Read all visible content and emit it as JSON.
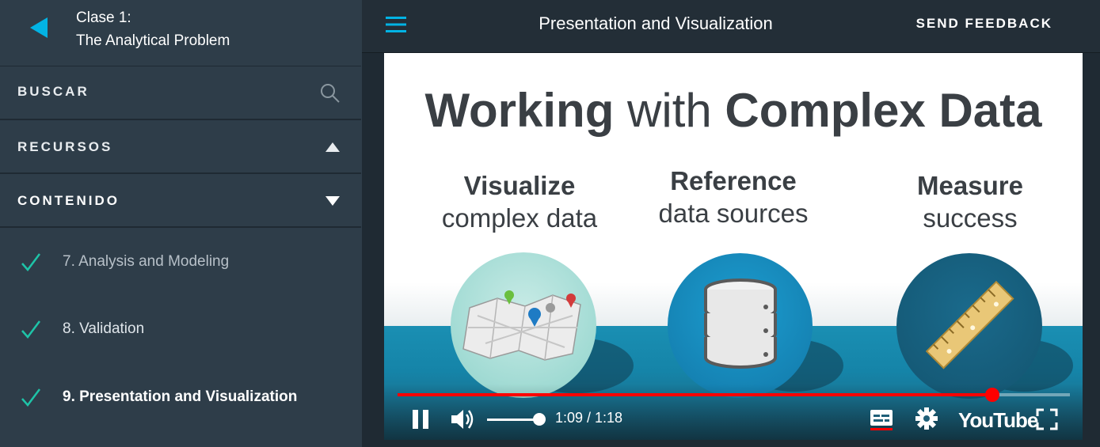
{
  "sidebar": {
    "course_line1": "Clase 1:",
    "course_line2": "The Analytical Problem",
    "buscar_label": "BUSCAR",
    "recursos_label": "RECURSOS",
    "contenido_label": "CONTENIDO",
    "lessons": [
      {
        "label": "7. Analysis and Modeling",
        "completed": true
      },
      {
        "label": "8. Validation",
        "completed": true
      },
      {
        "label": "9. Presentation and Visualization",
        "completed": true,
        "active": true
      }
    ]
  },
  "header": {
    "title": "Presentation and Visualization",
    "feedback_label": "SEND FEEDBACK"
  },
  "video": {
    "slide_title_bold1": "Working",
    "slide_title_regular": " with ",
    "slide_title_bold2": "Complex Data",
    "columns": [
      {
        "heading": "Visualize",
        "sub": "complex data",
        "icon": "map-icon"
      },
      {
        "heading": "Reference",
        "sub": "data sources",
        "icon": "database-icon"
      },
      {
        "heading": "Measure",
        "sub": "success",
        "icon": "ruler-icon"
      }
    ],
    "time_display": "1:09 / 1:18",
    "progress_fraction": 0.885,
    "volume_fraction": 0.9,
    "youtube_label": "YouTube"
  },
  "colors": {
    "sidebar_bg": "#2e3d49",
    "accent_blue": "#02b3e4",
    "check_green": "#1ec4a8",
    "progress_red": "#ff0000"
  }
}
